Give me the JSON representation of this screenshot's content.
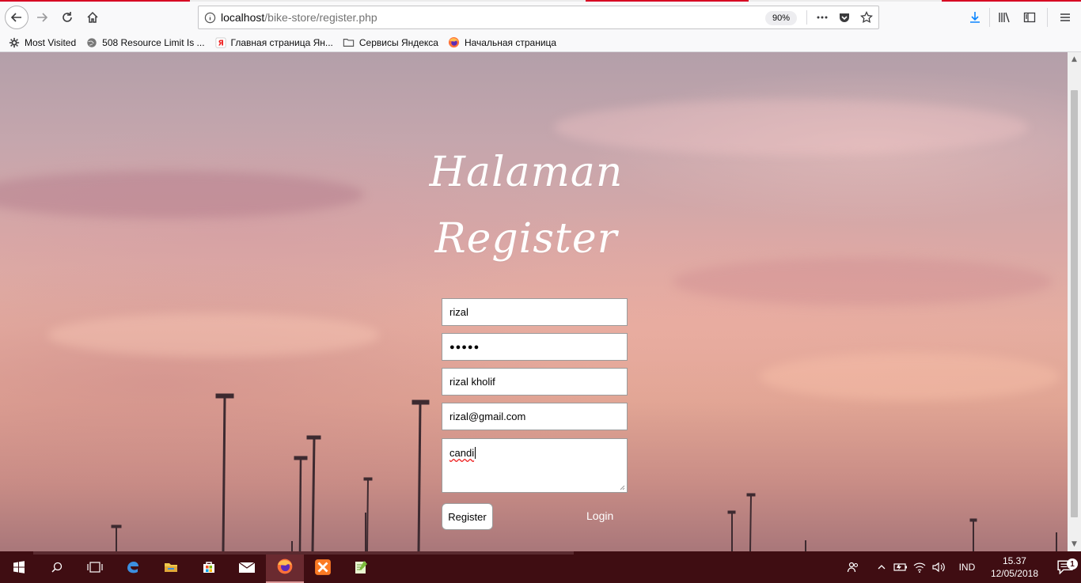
{
  "browser": {
    "url_host": "localhost",
    "url_path": "/bike-store/register.php",
    "zoom": "90%",
    "bookmarks": [
      {
        "label": "Most Visited",
        "icon": "gear-icon"
      },
      {
        "label": "508 Resource Limit Is ...",
        "icon": "globe-icon"
      },
      {
        "label": "Главная страница Ян...",
        "icon": "yandex-icon"
      },
      {
        "label": "Сервисы Яндекса",
        "icon": "folder-icon"
      },
      {
        "label": "Начальная страница",
        "icon": "firefox-icon"
      }
    ]
  },
  "page": {
    "title_line1": "Halaman",
    "title_line2": "Register",
    "form": {
      "username": "rizal",
      "password_mask": "●●●●●",
      "fullname": "rizal kholif",
      "email": "rizal@gmail.com",
      "address": "candi"
    },
    "register_label": "Register",
    "login_label": "Login"
  },
  "taskbar": {
    "time": "15.37",
    "date": "12/05/2018",
    "language": "IND",
    "notification_count": "1"
  }
}
